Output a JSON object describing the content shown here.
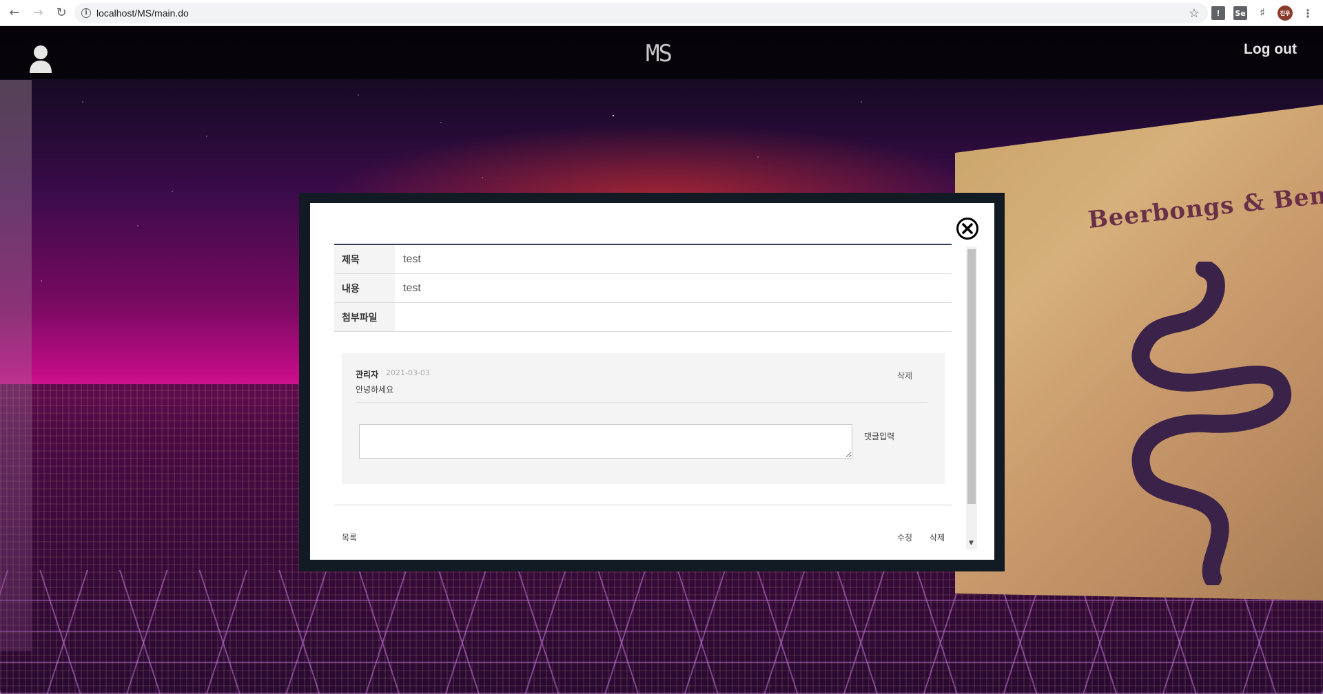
{
  "browser": {
    "url": "localhost/MS/main.do",
    "avatar_text": "진우",
    "ext_1": "!",
    "ext_2": "Se"
  },
  "header": {
    "logo": "MS",
    "logout_label": "Log out"
  },
  "background": {
    "album_title": "Beerbongs & Bentleys"
  },
  "post": {
    "title_label": "제목",
    "title_value": "test",
    "content_label": "내용",
    "content_value": "test",
    "file_label": "첨부파일",
    "file_value": ""
  },
  "comments": [
    {
      "author": "관리자",
      "date": "2021-03-03",
      "text": "안녕하세요",
      "delete_label": "삭제"
    }
  ],
  "comment_form": {
    "submit_label": "댓글입력",
    "value": ""
  },
  "actions": {
    "list_label": "목록",
    "edit_label": "수정",
    "delete_label": "삭제"
  }
}
